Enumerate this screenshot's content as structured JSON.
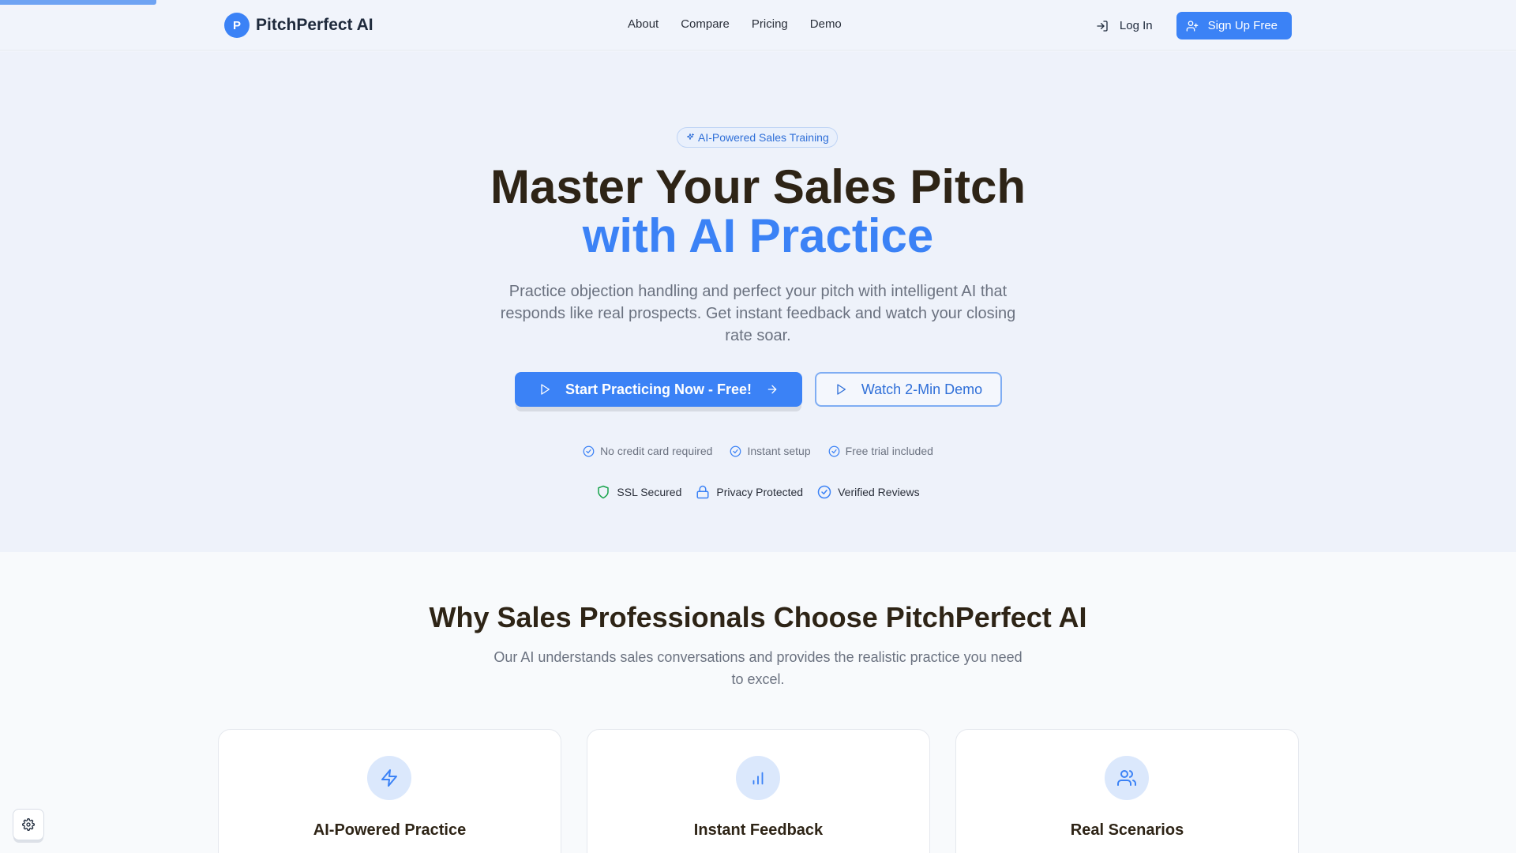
{
  "brand": {
    "logo_letter": "P",
    "name": "PitchPerfect AI"
  },
  "nav": [
    {
      "label": "About"
    },
    {
      "label": "Compare"
    },
    {
      "label": "Pricing"
    },
    {
      "label": "Demo"
    }
  ],
  "auth": {
    "login_label": "Log In",
    "signup_label": "Sign Up Free"
  },
  "hero": {
    "badge": "AI-Powered Sales Training",
    "title_line1": "Master Your Sales Pitch",
    "title_line2": "with AI Practice",
    "subtitle": "Practice objection handling and perfect your pitch with intelligent AI that responds like real prospects. Get instant feedback and watch your closing rate soar.",
    "cta_primary": "Start Practicing Now - Free!",
    "cta_secondary": "Watch 2-Min Demo",
    "perks": [
      "No credit card required",
      "Instant setup",
      "Free trial included"
    ],
    "trust": [
      "SSL Secured",
      "Privacy Protected",
      "Verified Reviews"
    ]
  },
  "features": {
    "title": "Why Sales Professionals Choose PitchPerfect AI",
    "subtitle": "Our AI understands sales conversations and provides the realistic practice you need to excel.",
    "cards": [
      {
        "title": "AI-Powered Practice",
        "icon": "lightning-icon"
      },
      {
        "title": "Instant Feedback",
        "icon": "bar-chart-icon"
      },
      {
        "title": "Real Scenarios",
        "icon": "users-icon"
      }
    ]
  },
  "colors": {
    "accent": "#3b82f6",
    "heading": "#2e2416",
    "muted": "#6b7280"
  }
}
